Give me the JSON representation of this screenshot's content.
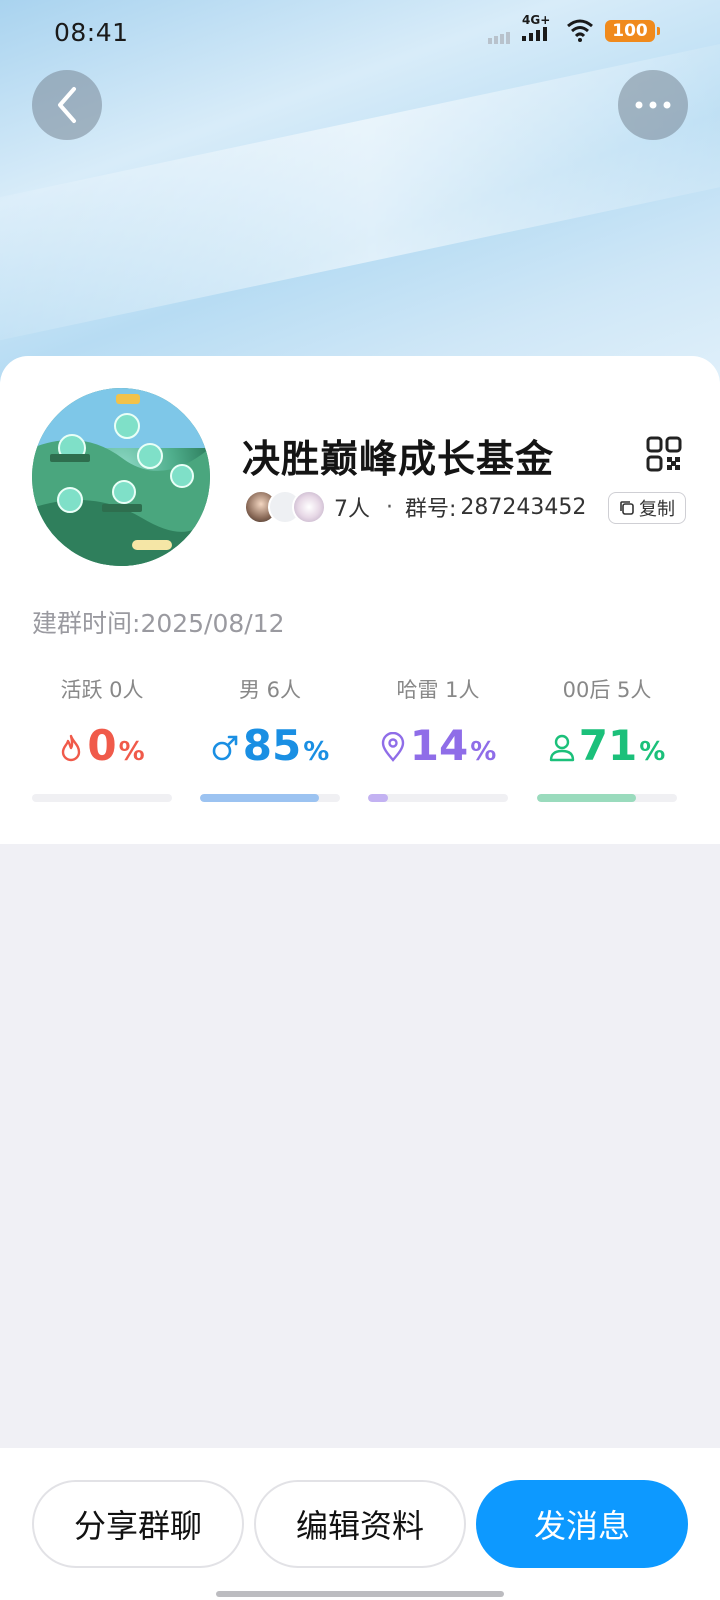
{
  "status_bar": {
    "time": "08:41",
    "network": "4G+",
    "battery": "100"
  },
  "header": {
    "back_icon": "chevron-left-icon",
    "more_icon": "more-dots-icon"
  },
  "group": {
    "name": "决胜巅峰成长基金",
    "member_count": "7人",
    "separator": "·",
    "id_label": "群号:",
    "id_value": "287243452",
    "copy_label": "复制",
    "created_label": "建群时间:",
    "created_value": "2025/08/12"
  },
  "stats": [
    {
      "label": "活跃 0人",
      "value": "0",
      "unit": "%",
      "fraction": 0.0,
      "color": "#f05a4a",
      "bar_color": "#f05a4a",
      "icon": "flame-icon"
    },
    {
      "label": "男 6人",
      "value": "85",
      "unit": "%",
      "fraction": 0.85,
      "color": "#1a8fe3",
      "bar_color": "#9cc3f1",
      "icon": "male-icon"
    },
    {
      "label": "哈雷 1人",
      "value": "14",
      "unit": "%",
      "fraction": 0.14,
      "color": "#8f6de8",
      "bar_color": "#c3b2f2",
      "icon": "location-pin-icon"
    },
    {
      "label": "00后 5人",
      "value": "71",
      "unit": "%",
      "fraction": 0.71,
      "color": "#1bc07a",
      "bar_color": "#9adbbd",
      "icon": "person-icon"
    }
  ],
  "actions": {
    "share": "分享群聊",
    "edit": "编辑资料",
    "send": "发消息"
  },
  "colors": {
    "primary": "#0d99ff",
    "card_bg": "#ffffff",
    "page_bg": "#f0f0f5"
  }
}
